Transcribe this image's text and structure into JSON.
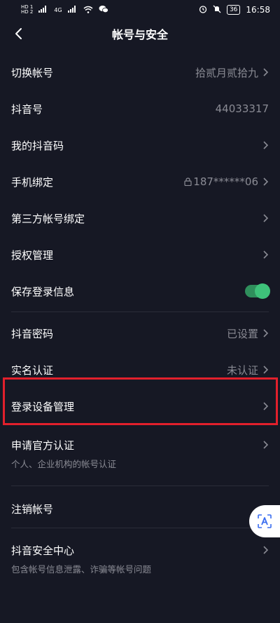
{
  "status_bar": {
    "left_top": "HD 1",
    "left_bottom": "HD 2",
    "network_1": "5G",
    "network_2": "4G",
    "battery": "36",
    "time": "16:58"
  },
  "nav": {
    "title": "帐号与安全"
  },
  "settings": {
    "switch_account": {
      "label": "切换帐号",
      "value": "拾贰月贰拾九"
    },
    "douyin_id": {
      "label": "抖音号",
      "value": "44033317"
    },
    "my_qr": {
      "label": "我的抖音码"
    },
    "phone_binding": {
      "label": "手机绑定",
      "value": "187******06"
    },
    "third_party": {
      "label": "第三方帐号绑定"
    },
    "authorization": {
      "label": "授权管理"
    },
    "save_login": {
      "label": "保存登录信息",
      "enabled": true
    },
    "password": {
      "label": "抖音密码",
      "value": "已设置"
    },
    "real_name": {
      "label": "实名认证",
      "value": "未认证"
    },
    "login_devices": {
      "label": "登录设备管理"
    },
    "official_cert": {
      "label": "申请官方认证",
      "subtitle": "个人、企业机构的帐号认证"
    },
    "cancel_account": {
      "label": "注销帐号"
    },
    "security_center": {
      "label": "抖音安全中心",
      "subtitle": "包含帐号信息泄露、诈骗等帐号问题"
    }
  },
  "colors": {
    "background": "#161824",
    "secondary_text": "#8a8b94",
    "toggle_on": "#3ec27a",
    "highlight": "#e2202c"
  }
}
